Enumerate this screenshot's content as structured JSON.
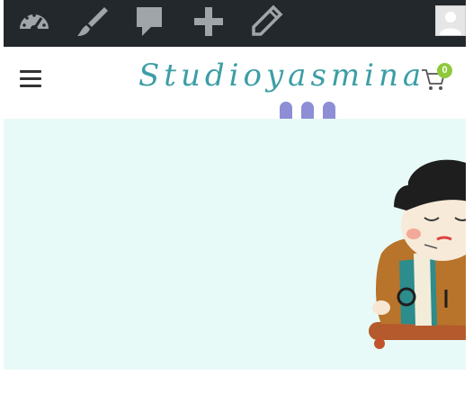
{
  "admin_bar": {
    "icons": [
      "dashboard-icon",
      "customize-brush-icon",
      "comments-icon",
      "new-content-plus-icon",
      "edit-pencil-icon"
    ],
    "avatar_icon": "user-avatar-icon",
    "background": "#23282d",
    "icon_color": "#a0a5aa"
  },
  "header": {
    "menu_icon": "hamburger-menu-icon",
    "logo": {
      "text_main": "Studioyasmina",
      "brand_color": "#3c9ea6",
      "accent_color": "#e0c23b",
      "bump_color": "#8e8ed6"
    },
    "cart": {
      "icon": "shopping-cart-icon",
      "count": "0",
      "badge_color": "#8fc93a"
    }
  },
  "hero": {
    "background": "#e8faf8",
    "illustration": "character-on-skateboard"
  }
}
